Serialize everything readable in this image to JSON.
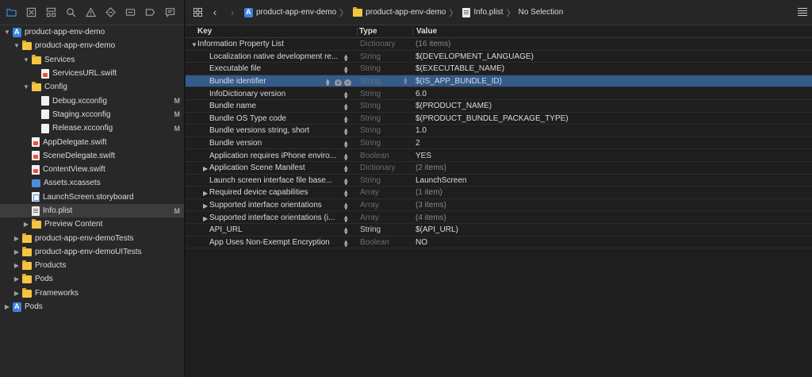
{
  "navigator": {
    "toolbar_icons": [
      "folder-icon",
      "source-control-icon",
      "hierarchy-icon",
      "search-icon",
      "warning-icon",
      "test-icon",
      "debug-icon",
      "breakpoint-icon",
      "report-icon"
    ],
    "tree": [
      {
        "label": "product-app-env-demo",
        "icon": "project",
        "depth": 0,
        "expanded": true,
        "badge": ""
      },
      {
        "label": "product-app-env-demo",
        "icon": "folder",
        "depth": 1,
        "expanded": true,
        "badge": ""
      },
      {
        "label": "Services",
        "icon": "folder",
        "depth": 2,
        "expanded": true,
        "badge": ""
      },
      {
        "label": "ServicesURL.swift",
        "icon": "swift",
        "depth": 3,
        "badge": ""
      },
      {
        "label": "Config",
        "icon": "folder",
        "depth": 2,
        "expanded": true,
        "badge": ""
      },
      {
        "label": "Debug.xcconfig",
        "icon": "file",
        "depth": 3,
        "badge": "M"
      },
      {
        "label": "Staging.xcconfig",
        "icon": "file",
        "depth": 3,
        "badge": "M"
      },
      {
        "label": "Release.xcconfig",
        "icon": "file",
        "depth": 3,
        "badge": "M"
      },
      {
        "label": "AppDelegate.swift",
        "icon": "swift",
        "depth": 2,
        "badge": ""
      },
      {
        "label": "SceneDelegate.swift",
        "icon": "swift",
        "depth": 2,
        "badge": ""
      },
      {
        "label": "ContentView.swift",
        "icon": "swift",
        "depth": 2,
        "badge": ""
      },
      {
        "label": "Assets.xcassets",
        "icon": "assets",
        "depth": 2,
        "badge": ""
      },
      {
        "label": "LaunchScreen.storyboard",
        "icon": "storyboard",
        "depth": 2,
        "badge": ""
      },
      {
        "label": "Info.plist",
        "icon": "plist",
        "depth": 2,
        "badge": "M",
        "selected": true
      },
      {
        "label": "Preview Content",
        "icon": "folder",
        "depth": 2,
        "expanded": false,
        "badge": ""
      },
      {
        "label": "product-app-env-demoTests",
        "icon": "folder",
        "depth": 1,
        "expanded": false,
        "badge": ""
      },
      {
        "label": "product-app-env-demoUITests",
        "icon": "folder",
        "depth": 1,
        "expanded": false,
        "badge": ""
      },
      {
        "label": "Products",
        "icon": "folder",
        "depth": 1,
        "expanded": false,
        "badge": ""
      },
      {
        "label": "Pods",
        "icon": "folder",
        "depth": 1,
        "expanded": false,
        "badge": ""
      },
      {
        "label": "Frameworks",
        "icon": "folder",
        "depth": 1,
        "expanded": false,
        "badge": ""
      },
      {
        "label": "Pods",
        "icon": "project",
        "depth": 0,
        "expanded": false,
        "badge": ""
      }
    ]
  },
  "jumpbar": {
    "back": "‹",
    "forward": "›",
    "crumbs": [
      {
        "label": "product-app-env-demo",
        "icon": "project"
      },
      {
        "label": "product-app-env-demo",
        "icon": "folder"
      },
      {
        "label": "Info.plist",
        "icon": "plist"
      },
      {
        "label": "No Selection",
        "icon": ""
      }
    ]
  },
  "plist": {
    "headers": {
      "key": "Key",
      "type": "Type",
      "value": "Value"
    },
    "rows": [
      {
        "key": "Information Property List",
        "type": "Dictionary",
        "value": "(16 items)",
        "root": true,
        "expandable": true
      },
      {
        "key": "Localization native development re...",
        "type": "String",
        "value": "$(DEVELOPMENT_LANGUAGE)"
      },
      {
        "key": "Executable file",
        "type": "String",
        "value": "$(EXECUTABLE_NAME)"
      },
      {
        "key": "Bundle identifier",
        "type": "String",
        "value": "$(IS_APP_BUNDLE_ID)",
        "selected": true
      },
      {
        "key": "InfoDictionary version",
        "type": "String",
        "value": "6.0"
      },
      {
        "key": "Bundle name",
        "type": "String",
        "value": "$(PRODUCT_NAME)"
      },
      {
        "key": "Bundle OS Type code",
        "type": "String",
        "value": "$(PRODUCT_BUNDLE_PACKAGE_TYPE)"
      },
      {
        "key": "Bundle versions string, short",
        "type": "String",
        "value": "1.0"
      },
      {
        "key": "Bundle version",
        "type": "String",
        "value": "2"
      },
      {
        "key": "Application requires iPhone enviro...",
        "type": "Boolean",
        "value": "YES"
      },
      {
        "key": "Application Scene Manifest",
        "type": "Dictionary",
        "value": "(2 items)",
        "expandable": true
      },
      {
        "key": "Launch screen interface file base...",
        "type": "String",
        "value": "LaunchScreen"
      },
      {
        "key": "Required device capabilities",
        "type": "Array",
        "value": "(1 item)",
        "expandable": true
      },
      {
        "key": "Supported interface orientations",
        "type": "Array",
        "value": "(3 items)",
        "expandable": true
      },
      {
        "key": "Supported interface orientations (i...",
        "type": "Array",
        "value": "(4 items)",
        "expandable": true
      },
      {
        "key": "API_URL",
        "type": "String",
        "value": "$(API_URL)",
        "bright_type": true
      },
      {
        "key": "App Uses Non-Exempt Encryption",
        "type": "Boolean",
        "value": "NO"
      }
    ]
  },
  "colors": {
    "selection_blue": "#335b8c",
    "navigator_bg": "#282828",
    "editor_bg": "#1e1e1e",
    "folder": "#f5c542"
  }
}
